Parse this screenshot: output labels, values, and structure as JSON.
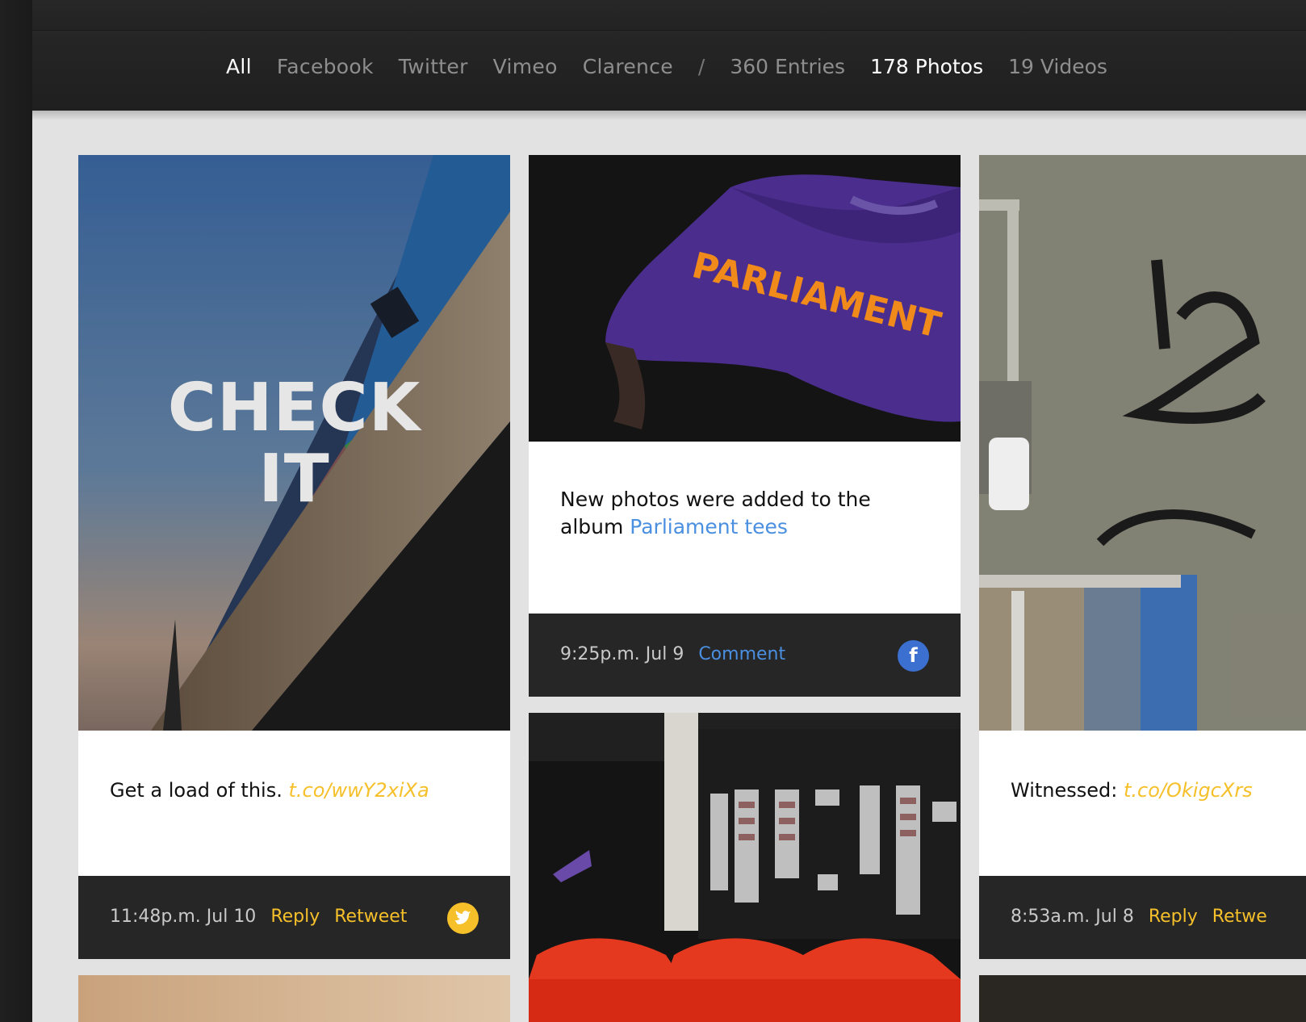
{
  "nav": {
    "filters": [
      "All",
      "Facebook",
      "Twitter",
      "Vimeo",
      "Clarence"
    ],
    "separator": "/",
    "entries": "360 Entries",
    "photos": "178 Photos",
    "videos": "19 Videos"
  },
  "cards": {
    "check_it": {
      "overlay_line1": "CHECK",
      "overlay_line2": "IT",
      "text": "Get a load of this. ",
      "link": "t.co/wwY2xiXa",
      "time": "11:48p.m. Jul 10",
      "action1": "Reply",
      "action2": "Retweet",
      "source_icon": "twitter-bird-icon"
    },
    "parliament": {
      "shirt_text": "PARLIAMENT",
      "text": "New photos were added to the album ",
      "link": "Parliament tees",
      "time": "9:25p.m. Jul 9",
      "action1": "Comment",
      "source_icon": "facebook-icon",
      "badge_letter": "f"
    },
    "witnessed": {
      "text": "Witnessed: ",
      "link": "t.co/OkigcXrs",
      "time": "8:53a.m. Jul 8",
      "action1": "Reply",
      "action2": "Retwe"
    }
  },
  "colors": {
    "twitter_accent": "#f6c02b",
    "facebook_accent": "#4a8fe0",
    "footer_bg": "#262626",
    "page_bg": "#e2e2e2"
  }
}
